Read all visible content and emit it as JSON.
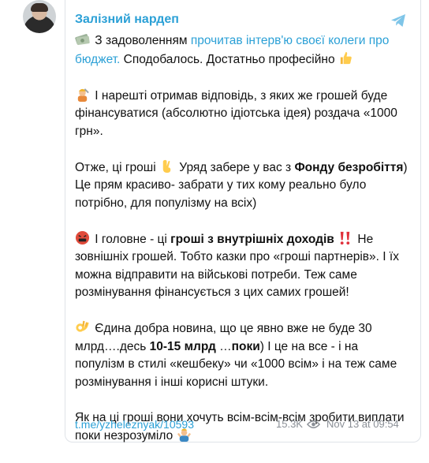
{
  "channel": {
    "name": "Залізний нардеп"
  },
  "post": {
    "p1_pre": " З задоволенням ",
    "p1_link": "прочитав інтерв'ю своєї колеги про бюджет.",
    "p1_post": " Сподобалось. Достатньо професійно ",
    "p2": " І нарешті отримав відповідь, з яких же грошей буде фінансуватися (абсолютно ідіотська ідея) роздача «1000 грн».",
    "p3_a": "Отже, ці гроші ",
    "p3_b": " Уряд забере у вас з ",
    "p3_bold": "Фонду безробіття",
    "p3_c": ") Це прям красиво- забрати у тих кому реально було потрібно, для популізму на всіх)",
    "p4_a": " І головне - ці ",
    "p4_bold": "гроші з внутрішніх доходів",
    "p4_b": " Не зовнішніх грошей. Тобто казки про «гроші партнерів». І їх можна відправити на військові потреби. Теж саме розмінування фінансується з цих самих грошей!",
    "p5_a": " Єдина добра новина, що це явно вже не буде 30 млрд….десь ",
    "p5_bold1": "10-15 млрд",
    "p5_b": " …",
    "p5_bold2": "поки",
    "p5_c": ") І це на все - і на популізм в стилі «кешбеку» чи «1000 всім» і на теж саме розмінування і інші корисні штуки.",
    "p6": "Як на ці гроші вони хочуть всім-всім-всім зробити виплати поки незрозуміло "
  },
  "footer": {
    "link": "t.me/yzheleznyak/10593",
    "views": "15.3K",
    "date": "Nov 13 at 09:54"
  },
  "icons": {
    "money": "banknotes-icon",
    "thumbs": "thumbs-up-icon",
    "worker": "mechanic-icon",
    "fingers": "crossed-fingers-icon",
    "angry": "cursing-face-icon",
    "bangs": "double-exclamation-icon",
    "ok": "ok-hand-icon",
    "shrug": "shrug-icon",
    "share": "share-icon",
    "eye": "eye-icon"
  },
  "colors": {
    "accent": "#2ba0d6",
    "meta": "#8a8f96"
  }
}
